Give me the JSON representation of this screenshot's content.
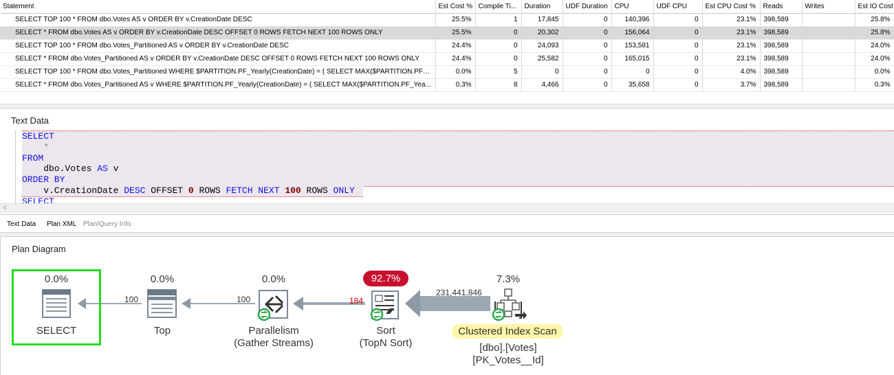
{
  "grid": {
    "columns": [
      "Statement",
      "Est Cost %",
      "Compile Ti...",
      "Duration",
      "UDF Duration",
      "CPU",
      "UDF CPU",
      "Est CPU Cost %",
      "Reads",
      "Writes",
      "Est IO Cost %"
    ],
    "rows": [
      {
        "statement": "SELECT TOP 100 * FROM dbo.Votes AS v ORDER BY v.CreationDate DESC",
        "est_cost": "25.5%",
        "compile": "1",
        "duration": "17,845",
        "udf_duration": "0",
        "cpu": "140,396",
        "udf_cpu": "0",
        "est_cpu": "23.1%",
        "reads": "398,589",
        "writes": "",
        "est_io": "25.8%"
      },
      {
        "statement": "SELECT * FROM dbo.Votes AS v ORDER BY v.CreationDate DESC OFFSET 0 ROWS FETCH NEXT 100 ROWS ONLY",
        "est_cost": "25.5%",
        "compile": "0",
        "duration": "20,302",
        "udf_duration": "0",
        "cpu": "156,064",
        "udf_cpu": "0",
        "est_cpu": "23.1%",
        "reads": "398,589",
        "writes": "",
        "est_io": "25.8%"
      },
      {
        "statement": "SELECT TOP 100 * FROM dbo.Votes_Partitioned AS v ORDER BY v.CreationDate DESC",
        "est_cost": "24.4%",
        "compile": "0",
        "duration": "24,093",
        "udf_duration": "0",
        "cpu": "153,581",
        "udf_cpu": "0",
        "est_cpu": "23.1%",
        "reads": "398,589",
        "writes": "",
        "est_io": "24.0%"
      },
      {
        "statement": "SELECT * FROM dbo.Votes_Partitioned AS v ORDER BY v.CreationDate DESC OFFSET 0 ROWS FETCH NEXT 100 ROWS ONLY",
        "est_cost": "24.4%",
        "compile": "0",
        "duration": "25,582",
        "udf_duration": "0",
        "cpu": "165,015",
        "udf_cpu": "0",
        "est_cpu": "23.1%",
        "reads": "398,589",
        "writes": "",
        "est_io": "24.0%"
      },
      {
        "statement": "SELECT TOP 100 * FROM dbo.Votes_Partitioned WHERE $PARTITION.PF_Yearly(CreationDate) = ( SELECT MAX($PARTITION.PF_...",
        "est_cost": "0.0%",
        "compile": "5",
        "duration": "0",
        "udf_duration": "0",
        "cpu": "0",
        "udf_cpu": "0",
        "est_cpu": "4.0%",
        "reads": "398,589",
        "writes": "",
        "est_io": "0.0%"
      },
      {
        "statement": "SELECT * FROM dbo.Votes_Partitioned AS v WHERE $PARTITION.PF_Yearly(CreationDate) = ( SELECT MAX($PARTITION.PF_Yea...",
        "est_cost": "0.3%",
        "compile": "8",
        "duration": "4,466",
        "udf_duration": "0",
        "cpu": "35,658",
        "udf_cpu": "0",
        "est_cpu": "3.7%",
        "reads": "398,589",
        "writes": "",
        "est_io": "0.3%"
      }
    ]
  },
  "text_data": {
    "title": "Text Data",
    "code_lines": {
      "l1_kw": "SELECT",
      "l2": "    *",
      "l3_kw": "FROM",
      "l4_a": "    dbo.Votes ",
      "l4_kw": "AS",
      "l4_b": " v",
      "l5_kw": "ORDER BY",
      "l6_a": "    v.CreationDate ",
      "l6_kw1": "DESC",
      "l6_b": " OFFSET ",
      "l6_n1": "0",
      "l6_c": " ROWS ",
      "l6_kw2": "FETCH NEXT",
      "l6_d": " ",
      "l6_n2": "100",
      "l6_e": " ROWS ",
      "l6_kw3": "ONLY",
      "l7_kw": "SELECT"
    },
    "scroll_left_glyph": "<"
  },
  "tabs": [
    "Text Data",
    "Plan XML",
    "Plan/Query Info"
  ],
  "plan": {
    "title": "Plan Diagram",
    "operators": [
      {
        "name": "SELECT",
        "cost": "0.0%"
      },
      {
        "name": "Top",
        "cost": "0.0%"
      },
      {
        "name": "Parallelism",
        "sub": "(Gather Streams)",
        "cost": "0.0%"
      },
      {
        "name": "Sort",
        "sub": "(TopN Sort)",
        "cost": "92.7%"
      },
      {
        "name": "Clustered Index Scan",
        "sub1": "[dbo].[Votes]",
        "sub2": "[PK_Votes__Id]",
        "cost": "7.3%"
      }
    ],
    "rows": {
      "select_top": "100",
      "top_par": "100",
      "par_sort": "184",
      "sort_scan": "231,441,846"
    },
    "colors": {
      "hot": "#c8102e",
      "selected": "#22dd22",
      "highlight": "#fdf6a8"
    },
    "icons": [
      "select-icon",
      "top-icon",
      "parallelism-icon",
      "sort-icon",
      "clustered-index-scan-icon"
    ]
  }
}
